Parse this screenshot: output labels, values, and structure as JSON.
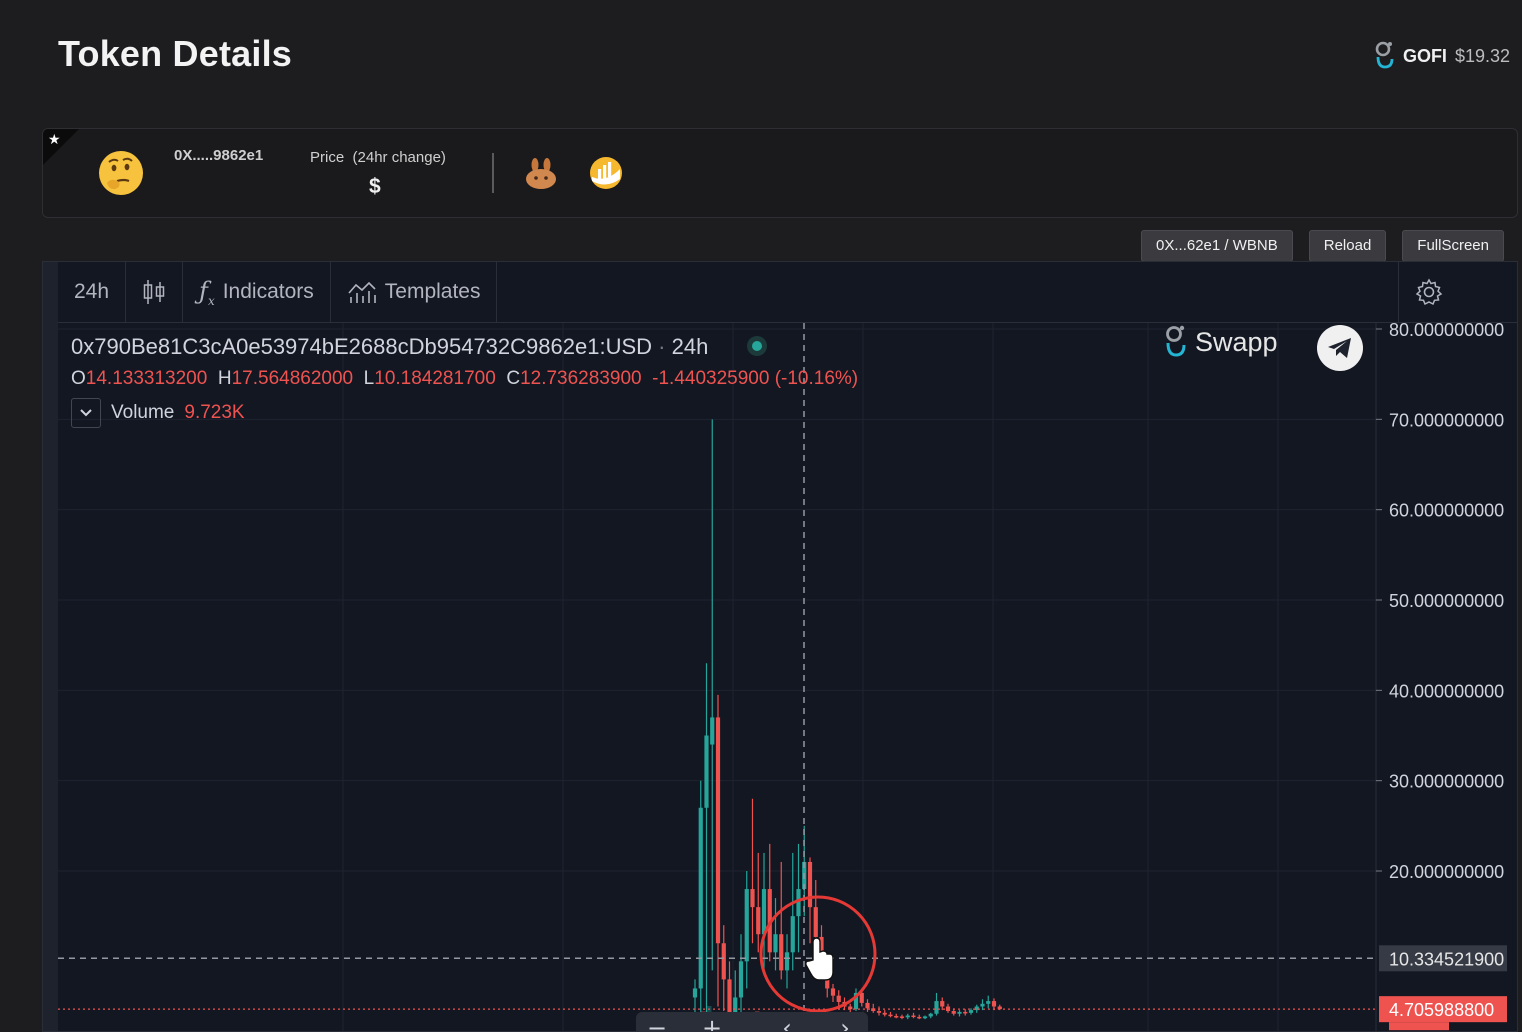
{
  "page": {
    "title": "Token Details",
    "header_token": {
      "symbol": "GOFI",
      "price": "$19.32"
    }
  },
  "token_card": {
    "address": "0X.....9862e1",
    "price_label": "Price",
    "price_change_label": "(24hr change)",
    "price_value": "$"
  },
  "buttons": {
    "pair": "0X...62e1 / WBNB",
    "reload": "Reload",
    "fullscreen": "FullScreen"
  },
  "chart_toolbar": {
    "interval": "24h",
    "indicators": "Indicators",
    "templates": "Templates"
  },
  "chart_header": {
    "symbol": "0x790Be81C3cA0e53974bE2688cDb954732C9862e1:USD",
    "interval": "24h",
    "ohlc": {
      "o_label": "O",
      "o": "14.133313200",
      "h_label": "H",
      "h": "17.564862000",
      "l_label": "L",
      "l": "10.184281700",
      "c_label": "C",
      "c": "12.736283900",
      "change": "-1.440325900 (-10.16%)"
    },
    "volume_label": "Volume",
    "volume_value": "9.723K"
  },
  "watermark": {
    "brand": "Swapp"
  },
  "colors": {
    "up": "#26a69a",
    "down": "#ef5350",
    "background": "#131722",
    "grid": "#1f2330",
    "crosshair": "#9598a1"
  },
  "chart_data": {
    "type": "candlestick",
    "y_axis_ticks": [
      "80.000000000",
      "70.000000000",
      "60.000000000",
      "50.000000000",
      "40.000000000",
      "30.000000000",
      "20.000000000"
    ],
    "ylim": [
      3.6,
      80
    ],
    "crosshair_price": "10.334521900",
    "last_price": "4.705988800",
    "candles": [
      {
        "o": 6,
        "h": 8,
        "l": 3.6,
        "c": 7
      },
      {
        "o": 7,
        "h": 30,
        "l": 3.6,
        "c": 27
      },
      {
        "o": 27,
        "h": 43,
        "l": 4,
        "c": 35
      },
      {
        "o": 34,
        "h": 70,
        "l": 9,
        "c": 37
      },
      {
        "o": 37,
        "h": 39.5,
        "l": 5,
        "c": 12
      },
      {
        "o": 12,
        "h": 14,
        "l": 4.5,
        "c": 8
      },
      {
        "o": 8,
        "h": 10,
        "l": 3.6,
        "c": 4
      },
      {
        "o": 4,
        "h": 9,
        "l": 3.6,
        "c": 6
      },
      {
        "o": 6,
        "h": 13,
        "l": 3.6,
        "c": 10
      },
      {
        "o": 10,
        "h": 20,
        "l": 7,
        "c": 18
      },
      {
        "o": 18,
        "h": 28,
        "l": 12,
        "c": 16
      },
      {
        "o": 16,
        "h": 22,
        "l": 11,
        "c": 13
      },
      {
        "o": 13,
        "h": 22,
        "l": 9,
        "c": 18
      },
      {
        "o": 18,
        "h": 23,
        "l": 10,
        "c": 11
      },
      {
        "o": 11,
        "h": 17,
        "l": 9,
        "c": 13
      },
      {
        "o": 13,
        "h": 21,
        "l": 8,
        "c": 9
      },
      {
        "o": 9,
        "h": 13,
        "l": 7,
        "c": 11
      },
      {
        "o": 11,
        "h": 22,
        "l": 9,
        "c": 15
      },
      {
        "o": 15,
        "h": 23,
        "l": 11,
        "c": 18
      },
      {
        "o": 18,
        "h": 25,
        "l": 15,
        "c": 21
      },
      {
        "o": 21,
        "h": 21.5,
        "l": 12,
        "c": 16
      },
      {
        "o": 16,
        "h": 19,
        "l": 12,
        "c": 12.7
      },
      {
        "o": 12.7,
        "h": 14,
        "l": 8,
        "c": 9
      },
      {
        "o": 9,
        "h": 10,
        "l": 6,
        "c": 7
      },
      {
        "o": 7,
        "h": 7.5,
        "l": 5.5,
        "c": 6.2
      },
      {
        "o": 6.2,
        "h": 6.8,
        "l": 5,
        "c": 5.5
      },
      {
        "o": 5.5,
        "h": 6,
        "l": 4.6,
        "c": 5
      },
      {
        "o": 5,
        "h": 5.3,
        "l": 4.3,
        "c": 4.7
      },
      {
        "o": 4.7,
        "h": 7,
        "l": 4.5,
        "c": 6.5
      },
      {
        "o": 6.5,
        "h": 7,
        "l": 5,
        "c": 5.4
      },
      {
        "o": 5.4,
        "h": 5.8,
        "l": 4.4,
        "c": 4.8
      },
      {
        "o": 4.8,
        "h": 5.3,
        "l": 4.3,
        "c": 4.5
      },
      {
        "o": 4.5,
        "h": 5,
        "l": 4,
        "c": 4.3
      },
      {
        "o": 4.3,
        "h": 4.6,
        "l": 3.9,
        "c": 4.1
      },
      {
        "o": 4.1,
        "h": 4.4,
        "l": 3.8,
        "c": 3.95
      },
      {
        "o": 3.95,
        "h": 4.2,
        "l": 3.7,
        "c": 3.9
      },
      {
        "o": 3.9,
        "h": 4.1,
        "l": 3.6,
        "c": 3.8
      },
      {
        "o": 3.8,
        "h": 4.2,
        "l": 3.6,
        "c": 4
      },
      {
        "o": 4,
        "h": 4.3,
        "l": 3.7,
        "c": 3.85
      },
      {
        "o": 3.85,
        "h": 4.1,
        "l": 3.6,
        "c": 3.7
      },
      {
        "o": 3.7,
        "h": 4,
        "l": 3.6,
        "c": 3.9
      },
      {
        "o": 3.9,
        "h": 4.3,
        "l": 3.7,
        "c": 4.2
      },
      {
        "o": 4.2,
        "h": 6.5,
        "l": 4,
        "c": 5.6
      },
      {
        "o": 5.6,
        "h": 6,
        "l": 4.6,
        "c": 5
      },
      {
        "o": 5,
        "h": 5.3,
        "l": 4.3,
        "c": 4.5
      },
      {
        "o": 4.5,
        "h": 4.8,
        "l": 4,
        "c": 4.2
      },
      {
        "o": 4.2,
        "h": 4.6,
        "l": 3.9,
        "c": 4.4
      },
      {
        "o": 4.4,
        "h": 4.7,
        "l": 4,
        "c": 4.3
      },
      {
        "o": 4.3,
        "h": 4.8,
        "l": 4.1,
        "c": 4.6
      },
      {
        "o": 4.6,
        "h": 5.2,
        "l": 4.3,
        "c": 5
      },
      {
        "o": 5,
        "h": 5.8,
        "l": 4.6,
        "c": 5.3
      },
      {
        "o": 5.3,
        "h": 6.2,
        "l": 4.8,
        "c": 5.6
      },
      {
        "o": 5.6,
        "h": 5.9,
        "l": 4.6,
        "c": 5
      },
      {
        "o": 5,
        "h": 5.2,
        "l": 4.6,
        "c": 4.71
      }
    ]
  }
}
